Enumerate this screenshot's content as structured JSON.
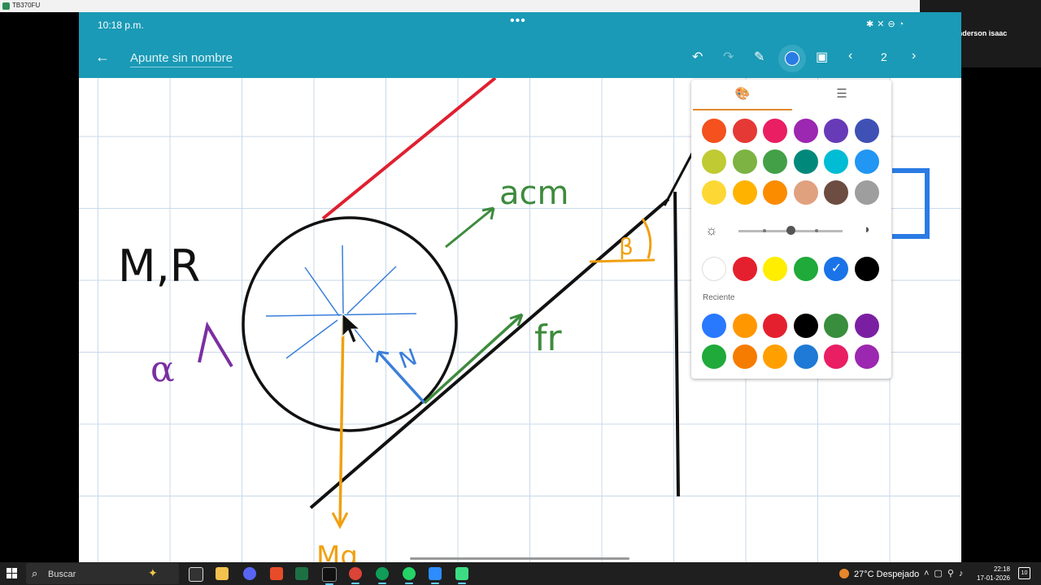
{
  "window": {
    "title": "TB370FU"
  },
  "participant": {
    "name": "anderson isaac"
  },
  "status_bar": {
    "time": "10:18 p.m.",
    "icons": [
      "bluetooth-icon",
      "mute-icon",
      "dnd-icon",
      "wifi-icon"
    ]
  },
  "toolbar": {
    "title": "Apunte sin nombre",
    "page": "2",
    "active_color": "#2a7be4",
    "icons": [
      "back-icon",
      "undo-icon",
      "redo-icon",
      "pen-icon",
      "color-icon",
      "image-icon",
      "prev-page-icon",
      "next-page-icon"
    ]
  },
  "color_picker": {
    "tabs": [
      {
        "icon": "palette-icon"
      },
      {
        "icon": "sliders-icon"
      }
    ],
    "palette": [
      "#f4511e",
      "#e53935",
      "#e91e63",
      "#9c27b0",
      "#673ab7",
      "#3f51b5",
      "#c0ca33",
      "#7cb342",
      "#43a047",
      "#00897b",
      "#00bcd4",
      "#2196f3",
      "#fdd835",
      "#ffb300",
      "#fb8c00",
      "#e0a17f",
      "#6d4c41",
      "#9e9e9e"
    ],
    "brightness": 0.5,
    "shades": [
      "#ffffff",
      "#e5202e",
      "#ffee00",
      "#1faa3a",
      "#1b73e8",
      "#000000"
    ],
    "selected_shade": "#1b73e8",
    "recent_label": "Reciente",
    "recent": [
      "#2979ff",
      "#ff9800",
      "#e5202e",
      "#000000",
      "#388e3c",
      "#7b1fa2",
      "#1faa3a",
      "#f57c00",
      "#ffa000",
      "#1e7ad6",
      "#e91e63",
      "#9c27b0"
    ]
  },
  "drawing": {
    "labels": [
      "M,R",
      "acm",
      "fr",
      "N",
      "β",
      "Mg",
      "α"
    ],
    "colors": {
      "black": "#111111",
      "red": "#e02030",
      "green": "#3d8b3d",
      "blue": "#3a7fd9",
      "orange": "#f0a010",
      "purple": "#7b2fa0"
    }
  },
  "taskbar": {
    "search_placeholder": "Buscar",
    "weather": "27°C  Despejado",
    "time": "22:18",
    "date": "17-01-2026",
    "notifications": "10",
    "apps": [
      "task-view",
      "file-explorer",
      "discord",
      "app-a",
      "excel",
      "terminal",
      "chrome",
      "chrome-alt",
      "whatsapp",
      "zoom",
      "android-app"
    ]
  }
}
